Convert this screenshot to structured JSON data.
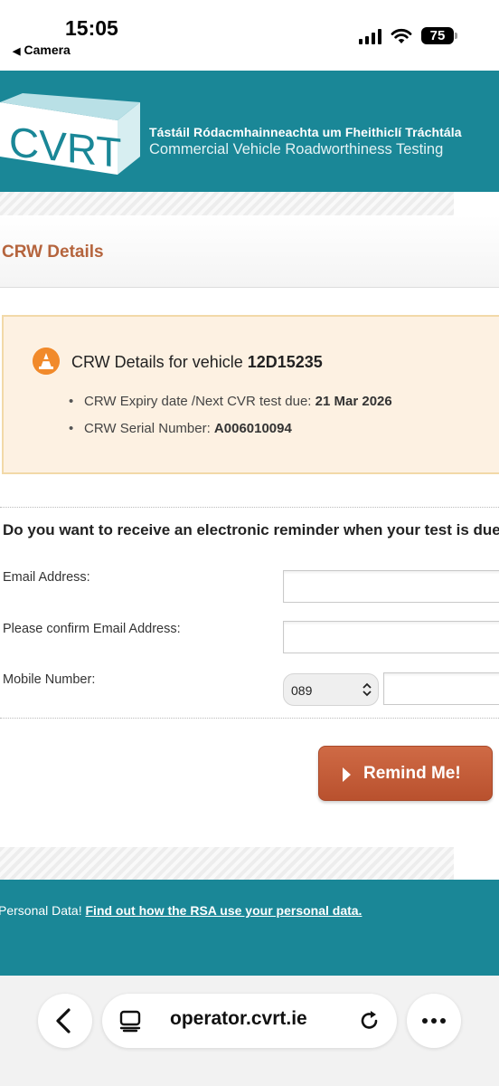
{
  "status_bar": {
    "time": "15:05",
    "back_label": "Camera",
    "battery": "75"
  },
  "header": {
    "logo_text": "CVRT",
    "irish_title": "Tástáil Ródacmhainneachta um Fheithiclí Tráchtála",
    "english_title": "Commercial Vehicle Roadworthiness Testing"
  },
  "section": {
    "title": "CRW Details"
  },
  "info": {
    "heading_prefix": "CRW Details for vehicle ",
    "vehicle": "12D15235",
    "items": [
      {
        "label": "CRW Expiry date /Next CVR test due: ",
        "value": "21 Mar 2026"
      },
      {
        "label": "CRW Serial Number: ",
        "value": "A006010094"
      }
    ]
  },
  "form": {
    "question": "Do you want to receive an electronic reminder when your test is due",
    "email_label": "Email Address:",
    "email_value": "",
    "confirm_label": "Please confirm Email Address:",
    "confirm_value": "",
    "mobile_label": "Mobile Number:",
    "mobile_prefix": "089",
    "mobile_value": "",
    "submit_label": "Remind Me!"
  },
  "footer": {
    "text": "Personal Data! ",
    "link": "Find out how the RSA use your personal data."
  },
  "browser": {
    "url": "operator.cvrt.ie"
  },
  "colors": {
    "brand_teal": "#1a8797",
    "title_orange": "#b5643d",
    "button_orange": "#c45d39",
    "info_bg": "#fdf1e2"
  }
}
